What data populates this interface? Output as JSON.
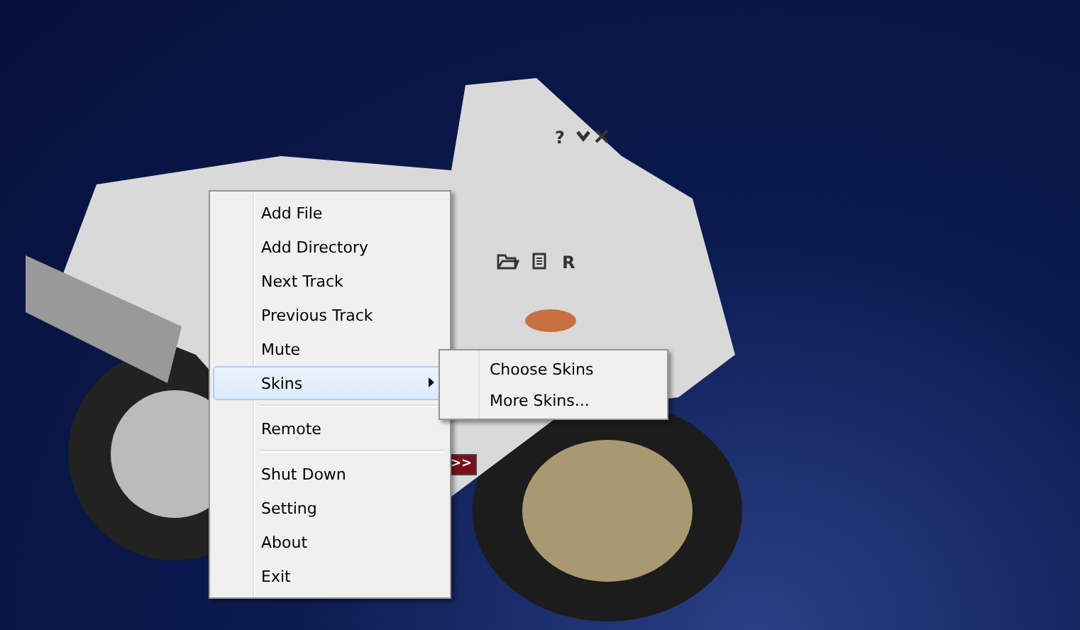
{
  "player": {
    "help_label": "?",
    "remote_label": "R",
    "forward_label": ">>"
  },
  "menu": {
    "items": [
      {
        "kind": "item",
        "label": "Add File",
        "selected": false,
        "has_submenu": false
      },
      {
        "kind": "item",
        "label": "Add Directory",
        "selected": false,
        "has_submenu": false
      },
      {
        "kind": "item",
        "label": "Next Track",
        "selected": false,
        "has_submenu": false
      },
      {
        "kind": "item",
        "label": "Previous Track",
        "selected": false,
        "has_submenu": false
      },
      {
        "kind": "item",
        "label": "Mute",
        "selected": false,
        "has_submenu": false
      },
      {
        "kind": "item",
        "label": "Skins",
        "selected": true,
        "has_submenu": true
      },
      {
        "kind": "separator"
      },
      {
        "kind": "item",
        "label": "Remote",
        "selected": false,
        "has_submenu": false
      },
      {
        "kind": "separator"
      },
      {
        "kind": "item",
        "label": "Shut Down",
        "selected": false,
        "has_submenu": false
      },
      {
        "kind": "item",
        "label": "Setting",
        "selected": false,
        "has_submenu": false
      },
      {
        "kind": "item",
        "label": "About",
        "selected": false,
        "has_submenu": false
      },
      {
        "kind": "item",
        "label": "Exit",
        "selected": false,
        "has_submenu": false
      }
    ]
  },
  "submenu": {
    "items": [
      {
        "label": "Choose Skins",
        "selected": false
      },
      {
        "label": "More Skins...",
        "selected": false
      }
    ]
  }
}
